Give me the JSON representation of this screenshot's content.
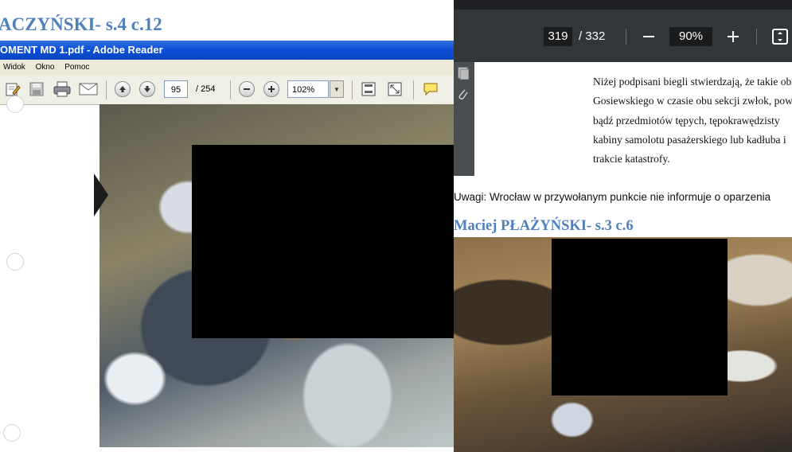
{
  "left_view": {
    "heading": "ACZYŃSKI- s.4 c.12",
    "window_title": "OMENT MD 1.pdf - Adobe Reader",
    "menu": [
      "Widok",
      "Okno",
      "Pomoc"
    ],
    "toolbar": {
      "page_value": "95",
      "page_total": "/ 254",
      "zoom_value": "102%"
    }
  },
  "pdf_viewer": {
    "page_current": "319",
    "page_total": "/ 332",
    "zoom": "90%",
    "document_lines": [
      "Niżej podpisani biegli stwierdzają, że takie obr",
      "Gosiewskiego w czasie obu sekcji zwłok, pows",
      "bądź  przedmiotów  tępych,  tępokrawędzisty",
      "kabiny samolotu pasażerskiego lub kadłuba i",
      "trakcie katastrofy."
    ],
    "note": "Uwagi: Wrocław w przywołanym punkcie nie informuje o oparzenia",
    "heading": "Maciej PŁAŻYŃSKI- s.3 c.6"
  },
  "colors": {
    "heading_blue": "#4f81bd",
    "xp_title_blue": "#0b4fd6",
    "viewer_toolbar": "#323639",
    "redaction": "#000000"
  }
}
